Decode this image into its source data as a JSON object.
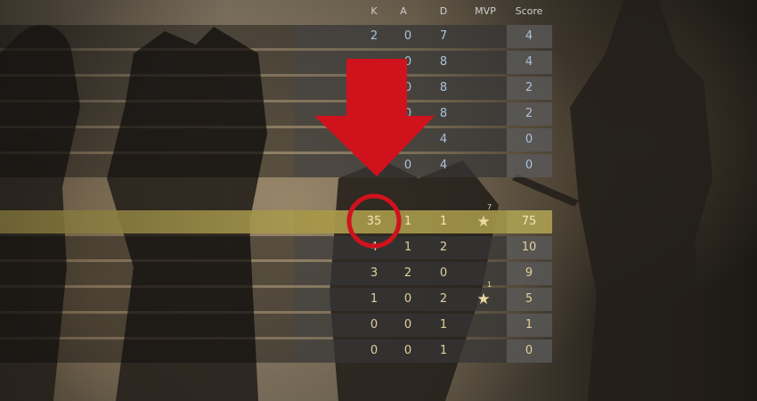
{
  "columns": {
    "kills": "K",
    "assists": "A",
    "deaths": "D",
    "mvp": "MVP",
    "score": "Score"
  },
  "team_ct": [
    {
      "k": "2",
      "a": "0",
      "d": "7",
      "score": "4"
    },
    {
      "k": "",
      "a": "0",
      "d": "8",
      "score": "4"
    },
    {
      "k": "",
      "a": "0",
      "d": "8",
      "score": "2"
    },
    {
      "k": "",
      "a": "0",
      "d": "8",
      "score": "2"
    },
    {
      "k": "",
      "a": "",
      "d": "4",
      "score": "0"
    },
    {
      "k": "",
      "a": "0",
      "d": "4",
      "score": "0"
    }
  ],
  "team_t": [
    {
      "k": "35",
      "a": "1",
      "d": "1",
      "mvp": "★",
      "mvp_count": "7",
      "score": "75",
      "highlight": true
    },
    {
      "k": "4",
      "a": "1",
      "d": "2",
      "mvp": "",
      "mvp_count": "",
      "score": "10"
    },
    {
      "k": "3",
      "a": "2",
      "d": "0",
      "mvp": "",
      "mvp_count": "",
      "score": "9"
    },
    {
      "k": "1",
      "a": "0",
      "d": "2",
      "mvp": "★",
      "mvp_count": "1",
      "score": "5"
    },
    {
      "k": "0",
      "a": "0",
      "d": "1",
      "mvp": "",
      "mvp_count": "",
      "score": "1"
    },
    {
      "k": "0",
      "a": "0",
      "d": "1",
      "mvp": "",
      "mvp_count": "",
      "score": "0"
    }
  ],
  "annotation": {
    "arrow_color": "#d0121d",
    "target": "kills-35"
  },
  "colors": {
    "ct_text": "#aac2de",
    "t_text": "#e1d09a",
    "highlight": "#b4a252"
  }
}
